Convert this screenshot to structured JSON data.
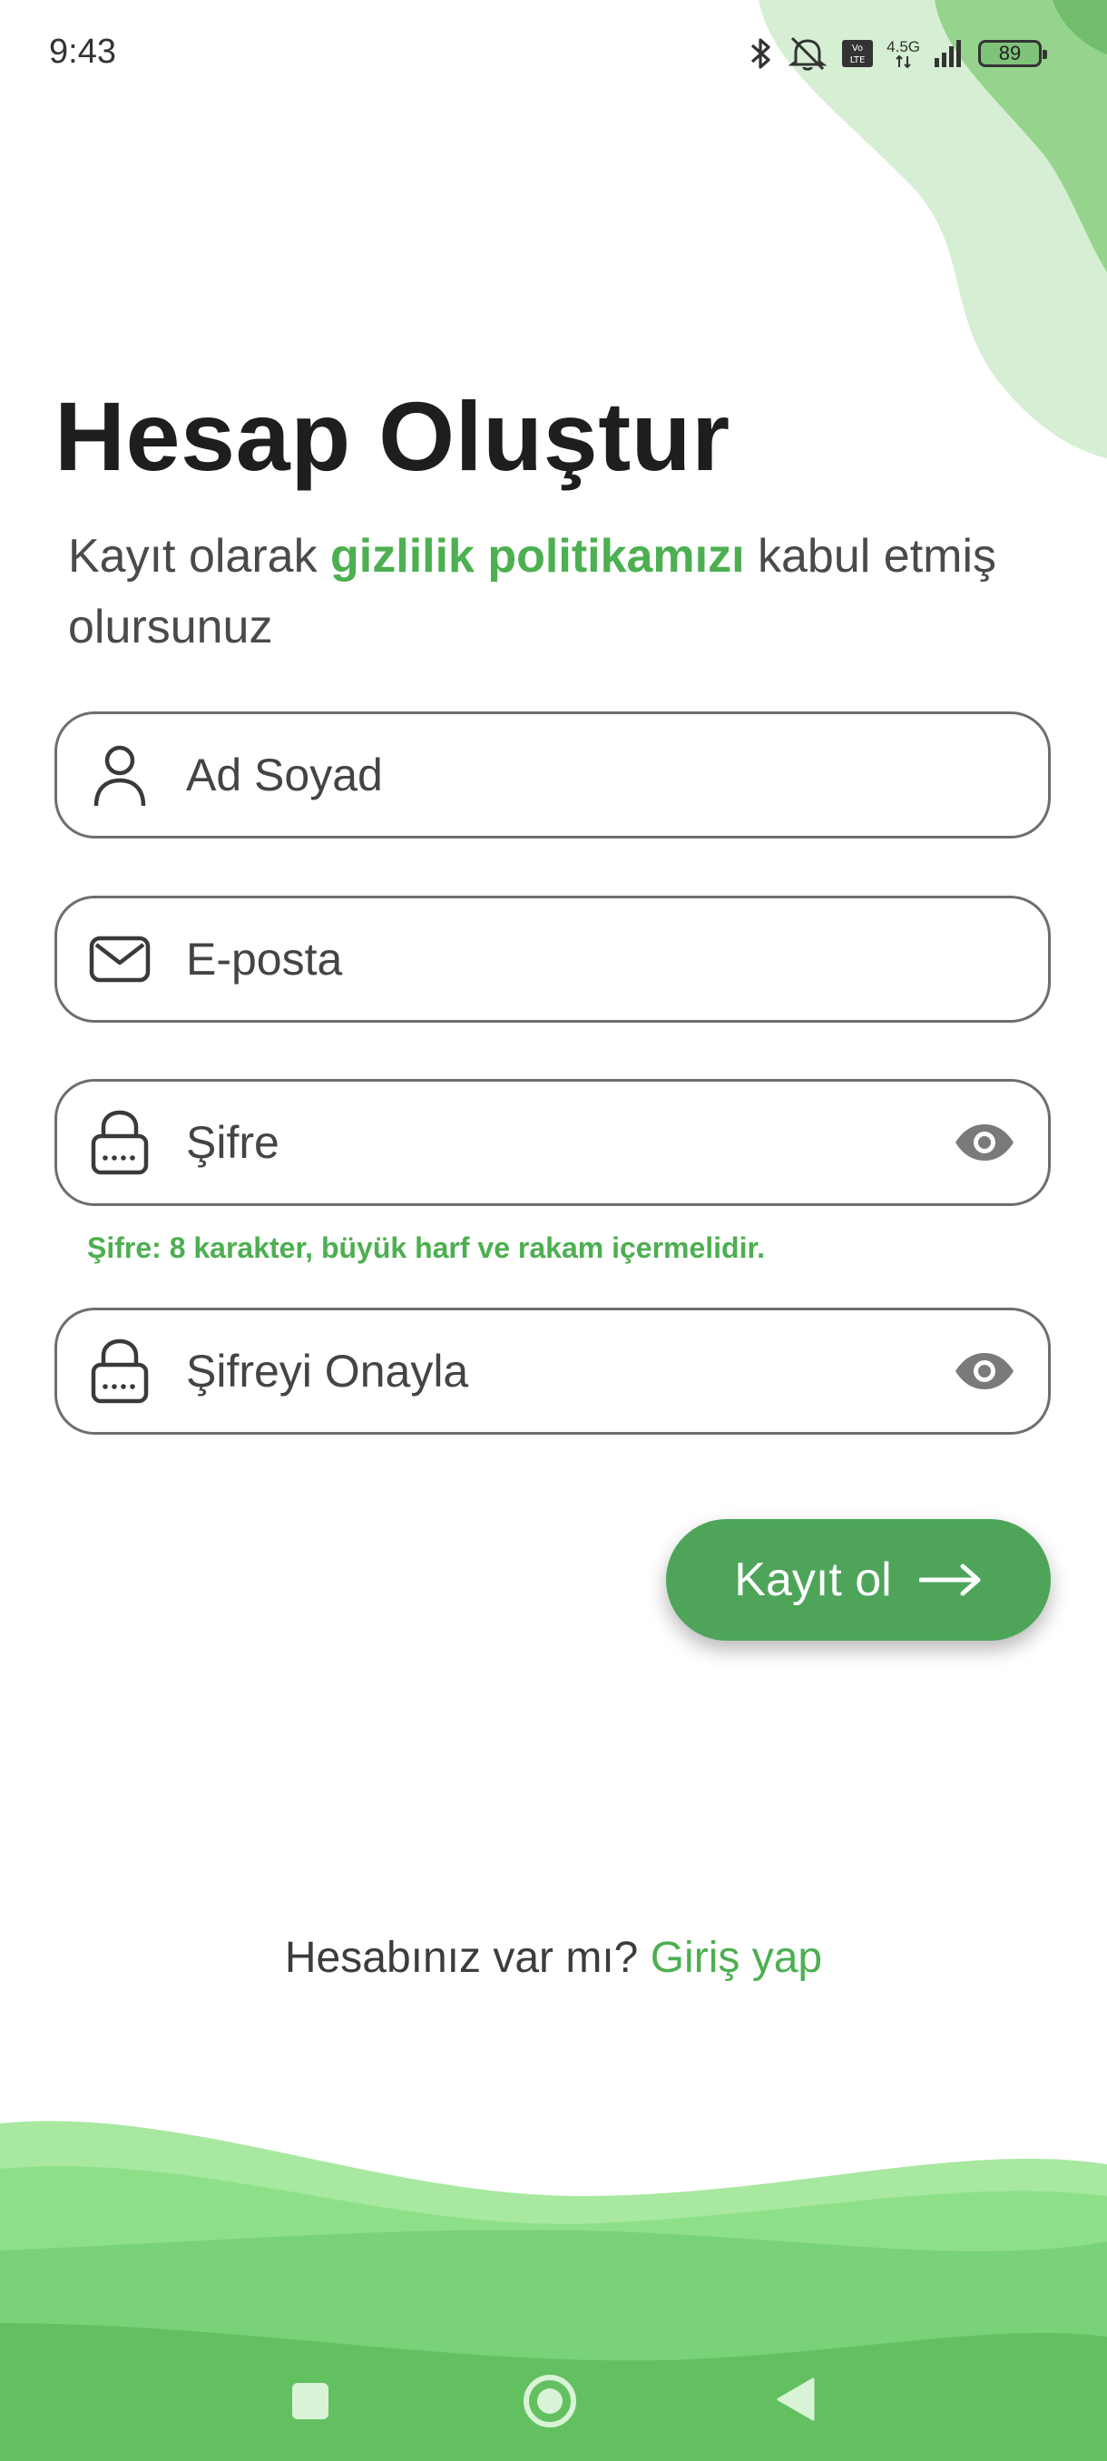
{
  "status_bar": {
    "time": "9:43",
    "network": "4.5G",
    "volte": "Vo LTE",
    "battery": "89"
  },
  "title": "Hesap Oluştur",
  "subtitle": {
    "prefix": "Kayıt olarak ",
    "highlight": "gizlilik politikamızı",
    "suffix": " kabul etmiş olursunuz"
  },
  "fields": {
    "name": {
      "placeholder": "Ad Soyad",
      "icon": "person-icon"
    },
    "email": {
      "placeholder": "E-posta",
      "icon": "mail-icon"
    },
    "password": {
      "placeholder": "Şifre",
      "icon": "lock-icon",
      "toggle_icon": "eye-icon"
    },
    "confirm": {
      "placeholder": "Şifreyi Onayla",
      "icon": "lock-icon",
      "toggle_icon": "eye-icon"
    }
  },
  "password_hint": "Şifre: 8 karakter, büyük harf ve rakam içermelidir.",
  "register_button": {
    "label": "Kayıt ol",
    "icon": "arrow-right-icon"
  },
  "login_prompt": {
    "question": "Hesabınız var mı? ",
    "link": "Giriş yap"
  },
  "nav": {
    "items": [
      "recents-icon",
      "home-icon",
      "back-icon"
    ]
  },
  "colors": {
    "accent": "#4caf50",
    "button": "#4ea55a",
    "wave_light": "#d6eed3",
    "wave_mid": "#8ee088",
    "wave_dark": "#62c061"
  }
}
